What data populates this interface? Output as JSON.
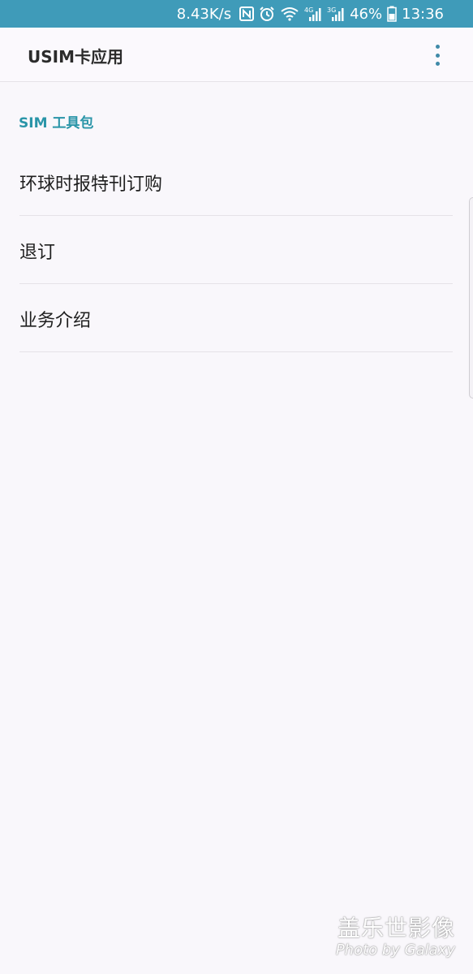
{
  "status_bar": {
    "network_speed": "8.43K/s",
    "nfc_icon": "nfc-icon",
    "alarm_icon": "alarm-icon",
    "wifi_icon": "wifi-icon",
    "signal_1_label": "4G",
    "signal_2_label": "3G",
    "battery_percent": "46%",
    "time": "13:36"
  },
  "app_bar": {
    "title": "USIM卡应用",
    "more_icon": "more-vert-icon"
  },
  "section": {
    "header": "SIM 工具包",
    "items": [
      {
        "label": "环球时报特刊订购"
      },
      {
        "label": "退订"
      },
      {
        "label": "业务介绍"
      }
    ]
  },
  "watermark": {
    "line1": "盖乐世影像",
    "line2": "Photo by Galaxy"
  },
  "colors": {
    "status_bar_bg": "#3f9bb9",
    "accent": "#2a95a8",
    "background": "#f9f7fb"
  }
}
